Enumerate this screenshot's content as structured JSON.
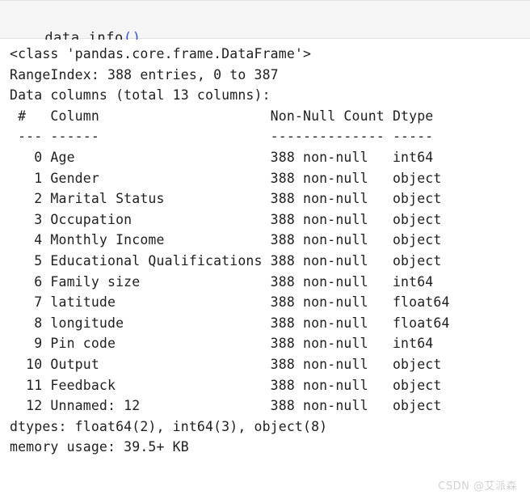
{
  "cell": {
    "code_tokens": [
      {
        "text": "data",
        "type": "name"
      },
      {
        "text": ".",
        "type": "dot"
      },
      {
        "text": "info",
        "type": "name"
      },
      {
        "text": "()",
        "type": "paren"
      }
    ],
    "code_text": "data.info()"
  },
  "output": {
    "class_line": "<class 'pandas.core.frame.DataFrame'>",
    "index_line": "RangeIndex: 388 entries, 0 to 387",
    "columns_line": "Data columns (total 13 columns):",
    "header": {
      "num": "#",
      "column": "Column",
      "non_null": "Non-Null Count",
      "dtype": "Dtype"
    },
    "separator": {
      "num": "---",
      "column": "------",
      "non_null": "--------------",
      "dtype": "-----"
    },
    "rows": [
      {
        "num": "0",
        "column": "Age",
        "non_null": "388 non-null",
        "dtype": "int64"
      },
      {
        "num": "1",
        "column": "Gender",
        "non_null": "388 non-null",
        "dtype": "object"
      },
      {
        "num": "2",
        "column": "Marital Status",
        "non_null": "388 non-null",
        "dtype": "object"
      },
      {
        "num": "3",
        "column": "Occupation",
        "non_null": "388 non-null",
        "dtype": "object"
      },
      {
        "num": "4",
        "column": "Monthly Income",
        "non_null": "388 non-null",
        "dtype": "object"
      },
      {
        "num": "5",
        "column": "Educational Qualifications",
        "non_null": "388 non-null",
        "dtype": "object"
      },
      {
        "num": "6",
        "column": "Family size",
        "non_null": "388 non-null",
        "dtype": "int64"
      },
      {
        "num": "7",
        "column": "latitude",
        "non_null": "388 non-null",
        "dtype": "float64"
      },
      {
        "num": "8",
        "column": "longitude",
        "non_null": "388 non-null",
        "dtype": "float64"
      },
      {
        "num": "9",
        "column": "Pin code",
        "non_null": "388 non-null",
        "dtype": "int64"
      },
      {
        "num": "10",
        "column": "Output",
        "non_null": "388 non-null",
        "dtype": "object"
      },
      {
        "num": "11",
        "column": "Feedback",
        "non_null": "388 non-null",
        "dtype": "object"
      },
      {
        "num": "12",
        "column": "Unnamed: 12",
        "non_null": "388 non-null",
        "dtype": "object"
      }
    ],
    "dtypes_line": "dtypes: float64(2), int64(3), object(8)",
    "memory_line": "memory usage: 39.5+ KB"
  },
  "watermark": {
    "text": "CSDN @艾派森"
  },
  "colors": {
    "cell_background": "#f5f5f5",
    "cell_border": "#e0e0e0",
    "text": "#1f1f1f",
    "punctuation_accent": "#b5236a",
    "paren_accent": "#3355cc",
    "watermark": "#d2d2d2"
  }
}
